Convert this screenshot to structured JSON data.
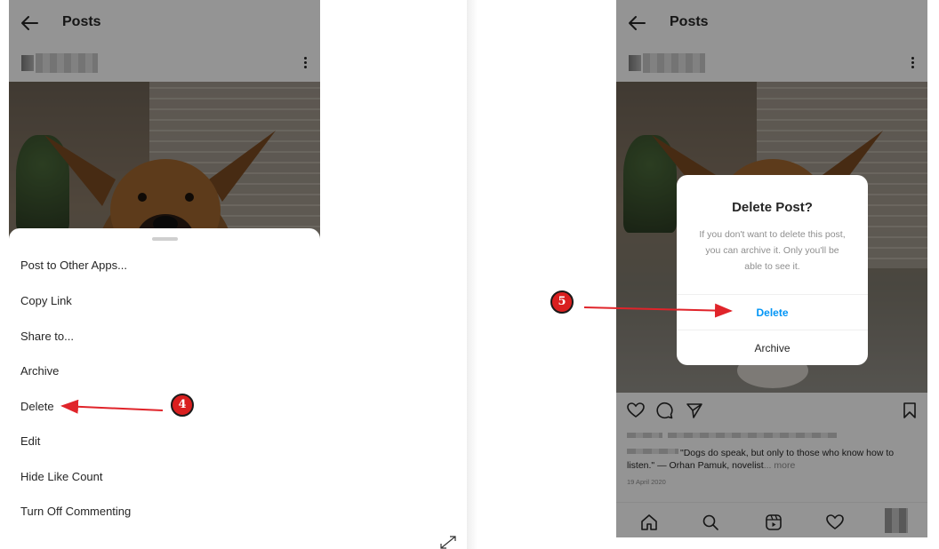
{
  "left_screen": {
    "title": "Posts",
    "menu_items": [
      "Post to Other Apps...",
      "Copy Link",
      "Share to...",
      "Archive",
      "Delete",
      "Edit",
      "Hide Like Count",
      "Turn Off Commenting"
    ]
  },
  "right_screen": {
    "title": "Posts",
    "dialog": {
      "title": "Delete Post?",
      "message": "If you don't want to delete this post, you can archive it. Only you'll be able to see it.",
      "delete_label": "Delete",
      "archive_label": "Archive"
    },
    "caption": {
      "text": "\"Dogs do speak, but only to those who know how to listen.\" — Orhan Pamuk, novelist",
      "more": "... more"
    },
    "date": "19 April 2020"
  },
  "annotations": {
    "step_left": "4",
    "step_right": "5",
    "arrow_color": "#e0242a"
  },
  "icons": [
    "back-icon",
    "more-options-icon",
    "heart-icon",
    "comment-icon",
    "share-icon",
    "bookmark-icon",
    "home-icon",
    "search-icon",
    "reels-icon",
    "activity-icon",
    "expand-icon"
  ]
}
